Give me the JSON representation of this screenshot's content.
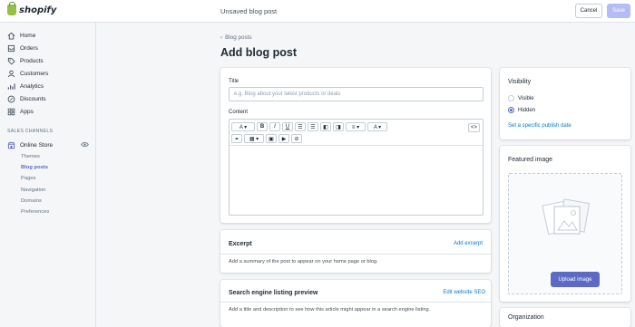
{
  "topbar": {
    "logo_text": "shopify",
    "status": "Unsaved blog post",
    "cancel_label": "Cancel",
    "save_label": "Save"
  },
  "sidebar": {
    "items": [
      {
        "label": "Home",
        "icon": "home-icon"
      },
      {
        "label": "Orders",
        "icon": "orders-icon"
      },
      {
        "label": "Products",
        "icon": "tag-icon"
      },
      {
        "label": "Customers",
        "icon": "person-icon"
      },
      {
        "label": "Analytics",
        "icon": "chart-icon"
      },
      {
        "label": "Discounts",
        "icon": "discount-icon"
      },
      {
        "label": "Apps",
        "icon": "apps-icon"
      }
    ],
    "sales_channels_label": "SALES CHANNELS",
    "online_store_label": "Online Store",
    "sub_items": [
      "Themes",
      "Blog posts",
      "Pages",
      "Navigation",
      "Domains",
      "Preferences"
    ],
    "active_sub_item": "Blog posts"
  },
  "main": {
    "breadcrumb": "Blog posts",
    "title": "Add blog post",
    "title_field": {
      "label": "Title",
      "placeholder": "e.g. Blog about your latest products or deals"
    },
    "content_label": "Content",
    "excerpt": {
      "heading": "Excerpt",
      "link": "Add excerpt",
      "description": "Add a summary of the post to appear on your home page or blog."
    },
    "seo": {
      "heading": "Search engine listing preview",
      "link": "Edit website SEO",
      "description": "Add a title and description to see how this article might appear in a search engine listing."
    }
  },
  "visibility": {
    "heading": "Visibility",
    "options": [
      "Visible",
      "Hidden"
    ],
    "selected": "Hidden",
    "link": "Set a specific publish date"
  },
  "featured_image": {
    "heading": "Featured image",
    "button": "Upload image"
  },
  "organization": {
    "heading": "Organization"
  },
  "colors": {
    "accent": "#5c6ac4",
    "link": "#007ace",
    "logo_green": "#95bf47"
  }
}
